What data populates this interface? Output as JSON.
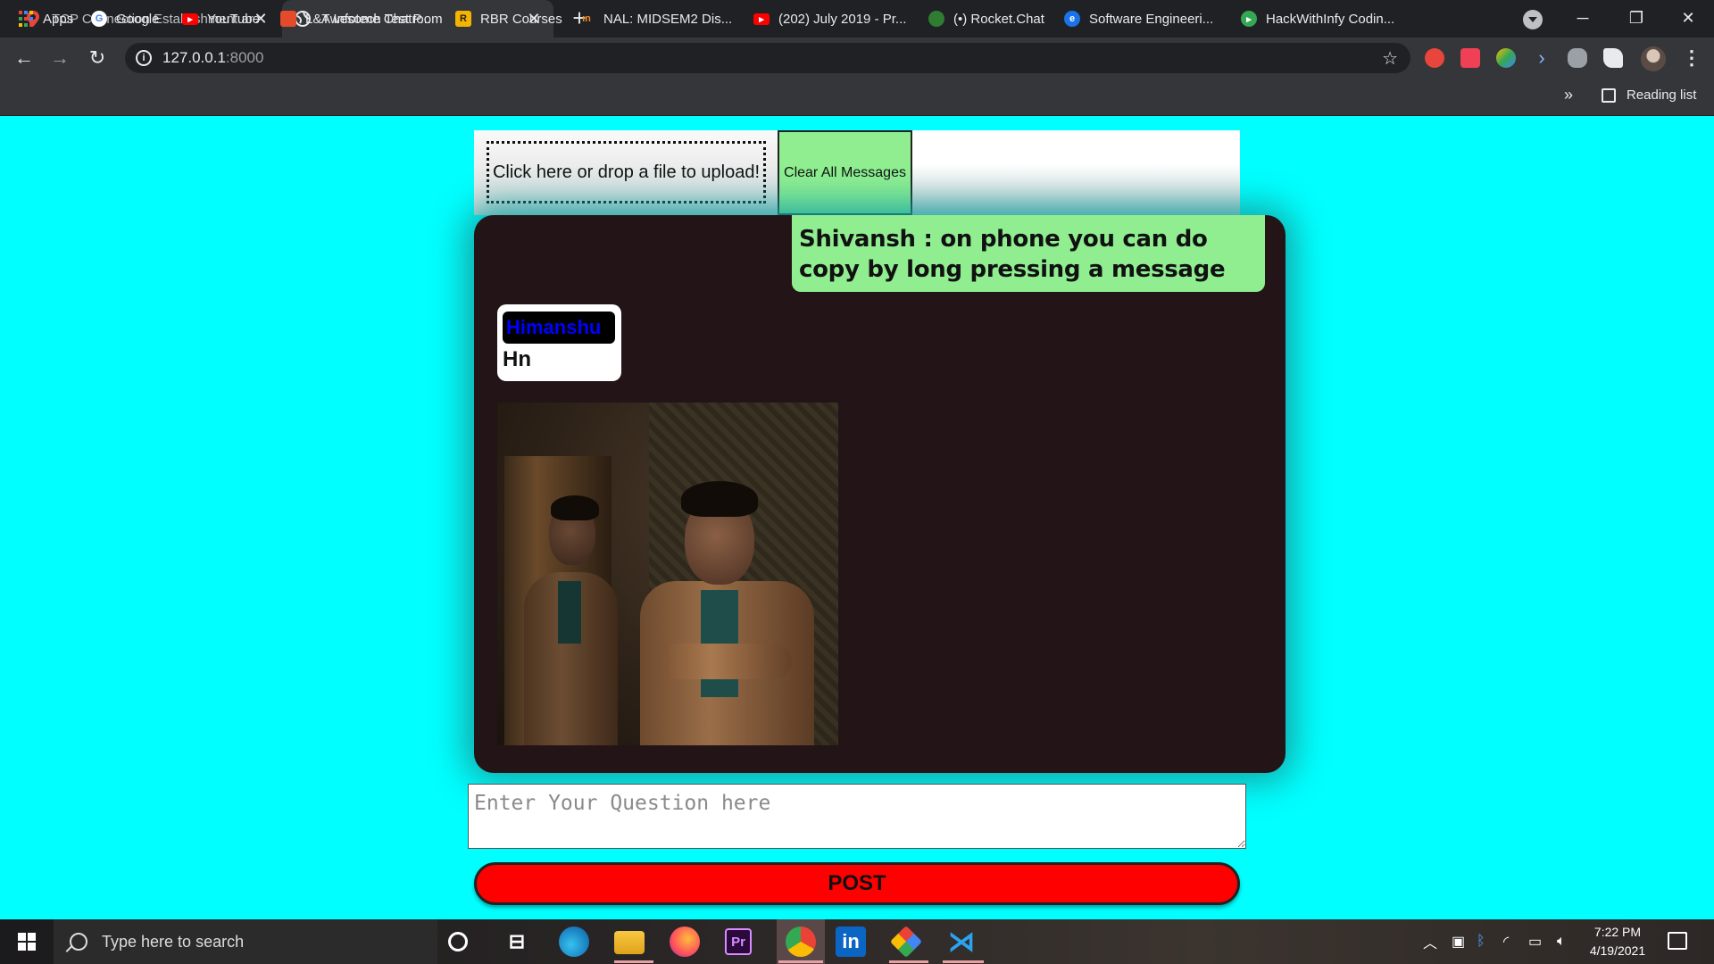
{
  "browser": {
    "tabs": [
      {
        "title": "TCP Connection Establishment ar",
        "active": false
      },
      {
        "title": "Awesome Chatroom",
        "active": true
      }
    ],
    "new_tab": "+",
    "url_host": "127.0.0.1",
    "url_port": ":8000",
    "bookmarks": [
      {
        "label": "Apps",
        "icon": "apps-grid-icon",
        "color": "#4285f4"
      },
      {
        "label": "Google",
        "icon": "google-icon",
        "color": "#ffffff"
      },
      {
        "label": "YouTube",
        "icon": "youtube-icon",
        "color": "#ff0000"
      },
      {
        "label": "L&T Infotech Test P...",
        "icon": "lti-icon",
        "color": "#e34b2a"
      },
      {
        "label": "RBR Courses",
        "icon": "rbr-icon",
        "color": "#f4b400"
      },
      {
        "label": "NAL: MIDSEM2 Dis...",
        "icon": "nal-icon",
        "color": "#f08a24"
      },
      {
        "label": "(202) July 2019 - Pr...",
        "icon": "youtube-icon",
        "color": "#ff0000"
      },
      {
        "label": "(•) Rocket.Chat",
        "icon": "rocketchat-icon",
        "color": "#2f7d32"
      },
      {
        "label": "Software Engineeri...",
        "icon": "edge-bookmark-icon",
        "color": "#1a73e8"
      },
      {
        "label": "HackWithInfy Codin...",
        "icon": "hackwithinfy-icon",
        "color": "#34a853"
      }
    ],
    "bookmarks_more": "»",
    "reading_list": "Reading list"
  },
  "page": {
    "upload_label": "Click here or drop a file to upload!",
    "clear_button": "Clear All Messages",
    "messages": [
      {
        "text": "Shivansh : on phone you can do copy by long pressing a message",
        "side": "right"
      },
      {
        "sender": "Himanshu",
        "text": "Hn",
        "side": "left"
      }
    ],
    "image_message": "photo-of-two-people",
    "question_placeholder": "Enter Your Question here",
    "post_button": "POST"
  },
  "colors": {
    "page_bg": "#00ffff",
    "chat_bg": "#231517",
    "bubble_right": "#90ee90",
    "post_button": "#ff0000",
    "sender_name": "#0000ff"
  },
  "taskbar": {
    "search_placeholder": "Type here to search",
    "time": "7:22 PM",
    "date": "4/19/2021"
  }
}
